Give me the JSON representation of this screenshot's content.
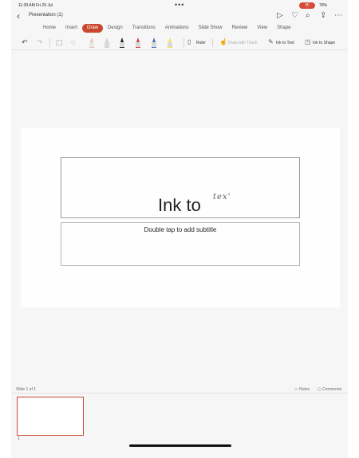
{
  "status_bar": {
    "time": "11:39 AM  Fri 29 Jul",
    "dots": "•••",
    "battery": "79%"
  },
  "title_bar": {
    "document_title": "Presentation (1)",
    "icons": [
      "chevron-left-icon",
      "play-icon",
      "lightbulb-icon",
      "search-icon",
      "share-icon",
      "more-icon"
    ]
  },
  "tabs": [
    {
      "label": "Home",
      "active": false
    },
    {
      "label": "Insert",
      "active": false
    },
    {
      "label": "Draw",
      "active": true
    },
    {
      "label": "Design",
      "active": false
    },
    {
      "label": "Transitions",
      "active": false
    },
    {
      "label": "Animations",
      "active": false
    },
    {
      "label": "Slide Show",
      "active": false
    },
    {
      "label": "Review",
      "active": false
    },
    {
      "label": "View",
      "active": false
    },
    {
      "label": "Shape",
      "active": false
    }
  ],
  "toolbar": {
    "ruler_label": "Ruler",
    "draw_with_touch_label": "Draw with Touch",
    "ink_to_text_label": "Ink to Text",
    "ink_to_shape_label": "Ink to Shape",
    "pen_colors": [
      "#f2b9b3",
      "#cfcfcf",
      "#222222",
      "#d23b3b",
      "#3e6fb5",
      "#f5e24a"
    ]
  },
  "slide": {
    "title_text": "Ink to",
    "ink_strokes": "tex'",
    "subtitle_placeholder": "Double tap to add subtitle"
  },
  "footer": {
    "slide_count": "Slide 1 of 1",
    "notes_label": "Notes",
    "comments_label": "Comments",
    "thumbnail_number": "1"
  }
}
